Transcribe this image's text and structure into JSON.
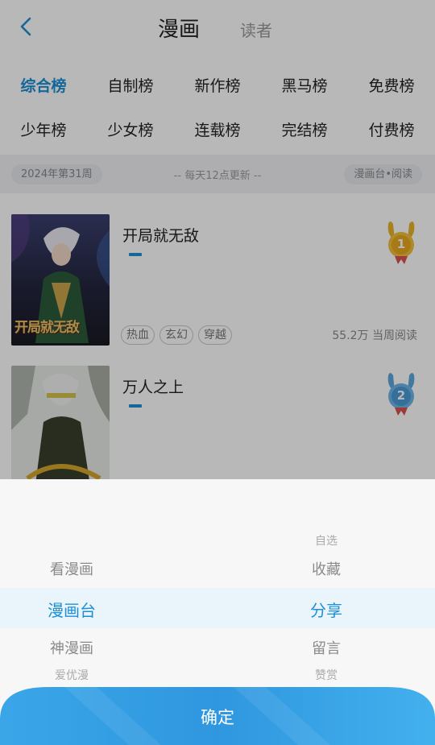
{
  "header": {
    "title": "漫画",
    "sub_title": "读者"
  },
  "tabs": {
    "row1": [
      "综合榜",
      "自制榜",
      "新作榜",
      "黑马榜",
      "免费榜"
    ],
    "row2": [
      "少年榜",
      "少女榜",
      "连载榜",
      "完结榜",
      "付费榜"
    ]
  },
  "info": {
    "week": "2024年第31周",
    "update": "-- 每天12点更新 --",
    "source": "漫画台•阅读"
  },
  "items": [
    {
      "title": "开局就无敌",
      "tags": [
        "热血",
        "玄幻",
        "穿越"
      ],
      "reads": "55.2万 当周阅读",
      "rank": "1",
      "cover_text": "开局就无敌"
    },
    {
      "title": "万人之上",
      "rank": "2"
    }
  ],
  "picker": {
    "left": [
      "看漫画",
      "漫画台",
      "神漫画",
      "爱优漫"
    ],
    "right": [
      "自选",
      "收藏",
      "分享",
      "留言",
      "赞赏"
    ],
    "left_selected": "漫画台",
    "right_selected": "分享"
  },
  "confirm_label": "确定",
  "colors": {
    "accent": "#1e8fd6",
    "gold": "#e8b32a",
    "blue_medal": "#5aa8e0"
  }
}
